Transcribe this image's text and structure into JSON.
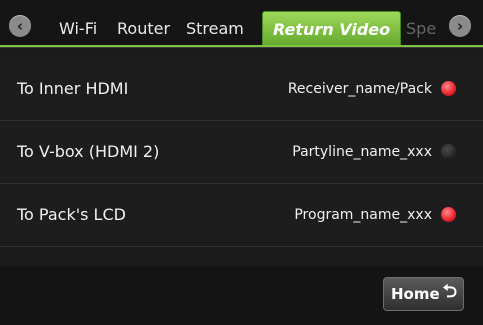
{
  "tabs": {
    "items": [
      "Wi-Fi",
      "Router",
      "Stream",
      "Return Video",
      "Spe"
    ],
    "active": "Return Video"
  },
  "nav": {
    "prev_icon": "chevron-left-icon",
    "next_icon": "chevron-right-icon"
  },
  "rows": [
    {
      "label": "To Inner HDMI",
      "value": "Receiver_name/Pack",
      "status": "on"
    },
    {
      "label": "To V-box (HDMI 2)",
      "value": "Partyline_name_xxx",
      "status": "off"
    },
    {
      "label": "To Pack's LCD",
      "value": "Program_name_xxx",
      "status": "on"
    }
  ],
  "home_button": {
    "label": "Home",
    "icon": "return-arrow-icon"
  },
  "colors": {
    "accent": "#7fc343",
    "status_on": "#e81f2a",
    "status_off": "#2a2a2a"
  }
}
